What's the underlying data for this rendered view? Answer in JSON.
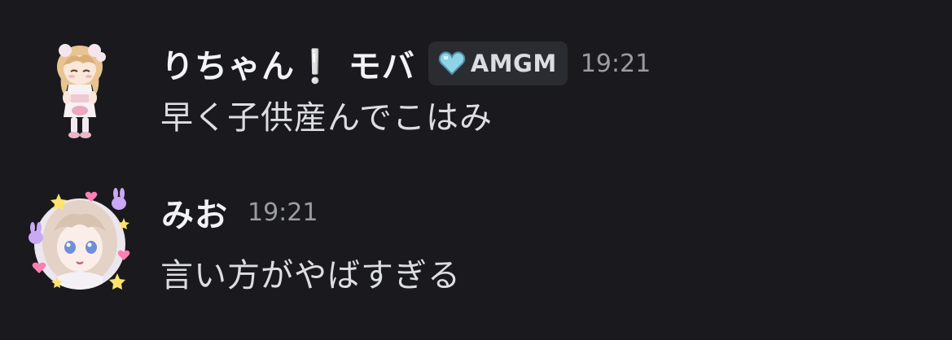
{
  "messages": [
    {
      "username": "りちゃん❕ モバ",
      "tag": {
        "label": "AMGM",
        "icon": "heart-icon",
        "color": "#8fd3e8"
      },
      "timestamp": "19:21",
      "text": "早く子供産んでこはみ",
      "avatar": "avatar-chibi-girl"
    },
    {
      "username": "みお",
      "timestamp": "19:21",
      "text": "言い方がやばすぎる",
      "avatar": "avatar-anime-girl"
    }
  ],
  "colors": {
    "background": "#1a1a1e",
    "username": "#f2f3f5",
    "message_text": "#dcdee3",
    "timestamp": "#9a9ca4",
    "tag_background": "#2b2c31"
  }
}
